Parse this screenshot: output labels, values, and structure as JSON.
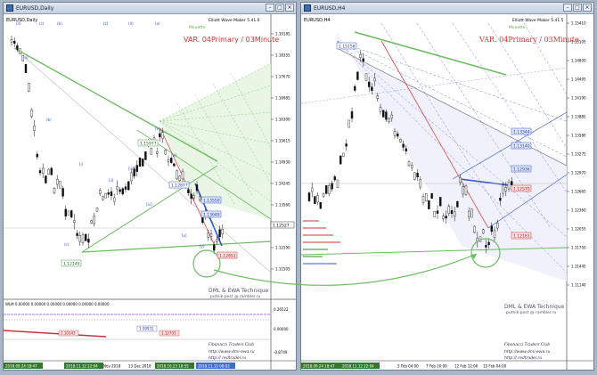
{
  "windows": [
    {
      "id": "left",
      "title": "EURUSD,Daily",
      "symbol_line": "EURUSD,Daily",
      "indicator": "Elliott Wave Maker 5.41.0",
      "badge": "Mouette",
      "variant": "VAR. 04Primary / 03Minute",
      "price_ticks": [
        "1.19185",
        "1.18355",
        "1.17670",
        "1.16985",
        "1.16300",
        "1.15615",
        "1.14930",
        "1.14245",
        "1.13560",
        "1.12875",
        "1.12190",
        "1.11505"
      ],
      "labels": {
        "start": "1.12149",
        "top": "1.15977",
        "box1": "1.13550",
        "box2": "1.13049",
        "box3": "1.12877",
        "box4": "1.12851",
        "cur": "1.12527"
      },
      "wave_tags": [
        "(4)",
        "(a)",
        "(b)",
        "(c)",
        "[i]",
        "[ii]",
        "[iii]",
        "[iv]",
        "[v]",
        "[w]",
        "[x]",
        "[y]",
        "[z]"
      ],
      "subwindow": {
        "title": "WLM 0.00000 0.00000 0.00000 0.00000 0.00000 0.00000",
        "ticks": [
          "0.26522",
          "0.00000",
          "-0.8749"
        ],
        "tag1": "1.10143",
        "tag2": "1.09931",
        "tag3": "1.12703"
      },
      "footer": {
        "tech": "DML & EWA Technique",
        "email": "putnik-post @ rambler.ru",
        "club": "Fibonacci Traders Club",
        "url1": "http://www.dmi-ewa.ru",
        "url2": "http:// redtrader.ru"
      },
      "dates": [
        "2018.09.24 18:47",
        "2018.11.12 22:04",
        "Nov 2018",
        "13 Dec 2018",
        "2018.10.23 18:55",
        "2018.11.15 08:03"
      ]
    },
    {
      "id": "right",
      "title": "EURUSD,H4",
      "symbol_line": "EURUSD,H4",
      "indicator": "Elliott Wave Maker 5.41.5",
      "badge": "Mouette",
      "variant": "VAR. 04Primary / 03Minute",
      "price_ticks": [
        "1.15410",
        "1.15105",
        "1.14800",
        "1.14495",
        "1.14190",
        "1.13885",
        "1.13580",
        "1.13275",
        "1.12970",
        "1.12665",
        "1.12360",
        "1.12055",
        "1.11750",
        "1.11445",
        "1.11140"
      ],
      "labels": {
        "top": "1.15158",
        "box1": "1.13344",
        "box2": "1.13140",
        "box3": "1.12936",
        "box4": "1.12570",
        "box5": "1.12161"
      },
      "footer": {
        "tech": "DML & EWA Technique",
        "email": "putnik-post @ rambler.ru",
        "club": "Fibonacci Traders Club",
        "url1": "http://www.dmi-ewa.ru",
        "url2": "http:// redtrader.ru"
      },
      "dates": [
        "2018.09.24 18:47",
        "2018.11.12 22:04",
        "5 Feb 04:00",
        "7 Feb 20:00",
        "12 Feb 12:00",
        "15 Feb 04:00"
      ]
    }
  ]
}
